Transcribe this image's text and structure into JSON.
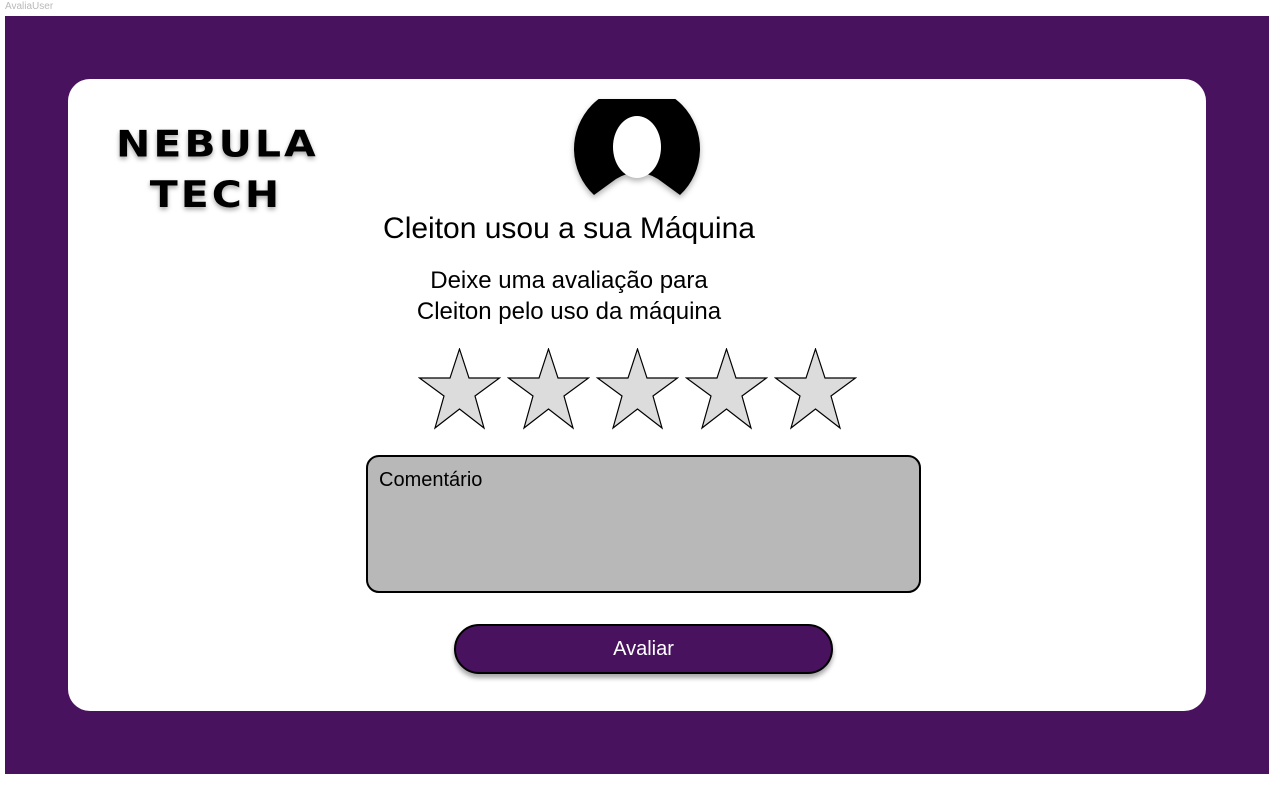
{
  "frame": {
    "label": "AvaliaUser"
  },
  "logo": {
    "line1": "NEBULA",
    "line2": "TECH"
  },
  "avatar": {
    "icon": "user-avatar-icon"
  },
  "title": "Cleiton usou a sua Máquina",
  "subtitle": {
    "line1": "Deixe uma avaliação para",
    "line2": "Cleiton pelo uso da máquina"
  },
  "rating": {
    "max": 5,
    "value": 0,
    "star_fill": "#dcdcdc",
    "star_stroke": "#000000"
  },
  "comment": {
    "placeholder": "Comentário",
    "value": ""
  },
  "submit": {
    "label": "Avaliar"
  },
  "colors": {
    "brand": "#48125e",
    "card": "#ffffff",
    "input_bg": "#b8b8b8"
  }
}
